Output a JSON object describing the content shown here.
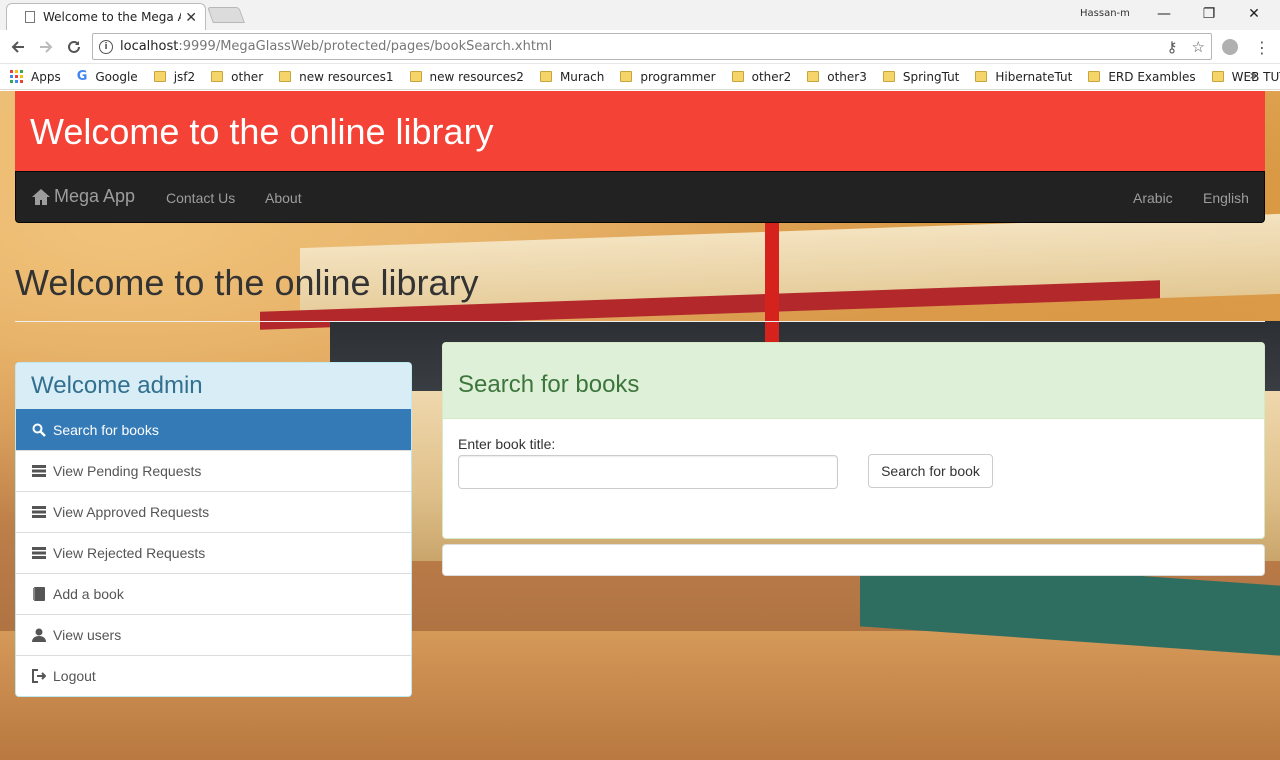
{
  "browser": {
    "tab_title": "Welcome to the Mega Ap",
    "user": "Hassan-m",
    "url_host": "localhost",
    "url_path": ":9999/MegaGlassWeb/protected/pages/bookSearch.xhtml",
    "bookmarks": [
      "Apps",
      "Google",
      "jsf2",
      "other",
      "new resources1",
      "new resources2",
      "Murach",
      "programmer",
      "other2",
      "other3",
      "SpringTut",
      "HibernateTut",
      "ERD Exambles",
      "WEB TUT"
    ],
    "more": "»"
  },
  "banner": {
    "title": "Welcome to the online library"
  },
  "navbar": {
    "brand": "Mega App",
    "links": [
      "Contact Us",
      "About"
    ],
    "languages": [
      "Arabic",
      "English"
    ]
  },
  "page": {
    "header": "Welcome to the online library"
  },
  "sidebar": {
    "heading": "Welcome admin",
    "items": [
      {
        "label": "Search for books",
        "icon": "search-icon"
      },
      {
        "label": "View Pending Requests",
        "icon": "list-icon"
      },
      {
        "label": "View Approved Requests",
        "icon": "list-icon"
      },
      {
        "label": "View Rejected Requests",
        "icon": "list-icon"
      },
      {
        "label": "Add a book",
        "icon": "book-icon"
      },
      {
        "label": "View users",
        "icon": "user-icon"
      },
      {
        "label": "Logout",
        "icon": "logout-icon"
      }
    ]
  },
  "search": {
    "heading": "Search for books",
    "label": "Enter book title:",
    "value": "",
    "button": "Search for book"
  },
  "colors": {
    "banner": "#f44336",
    "navbar": "#222222",
    "active": "#337ab7",
    "panel_info": "#d9edf7",
    "panel_success": "#dff0d8"
  }
}
